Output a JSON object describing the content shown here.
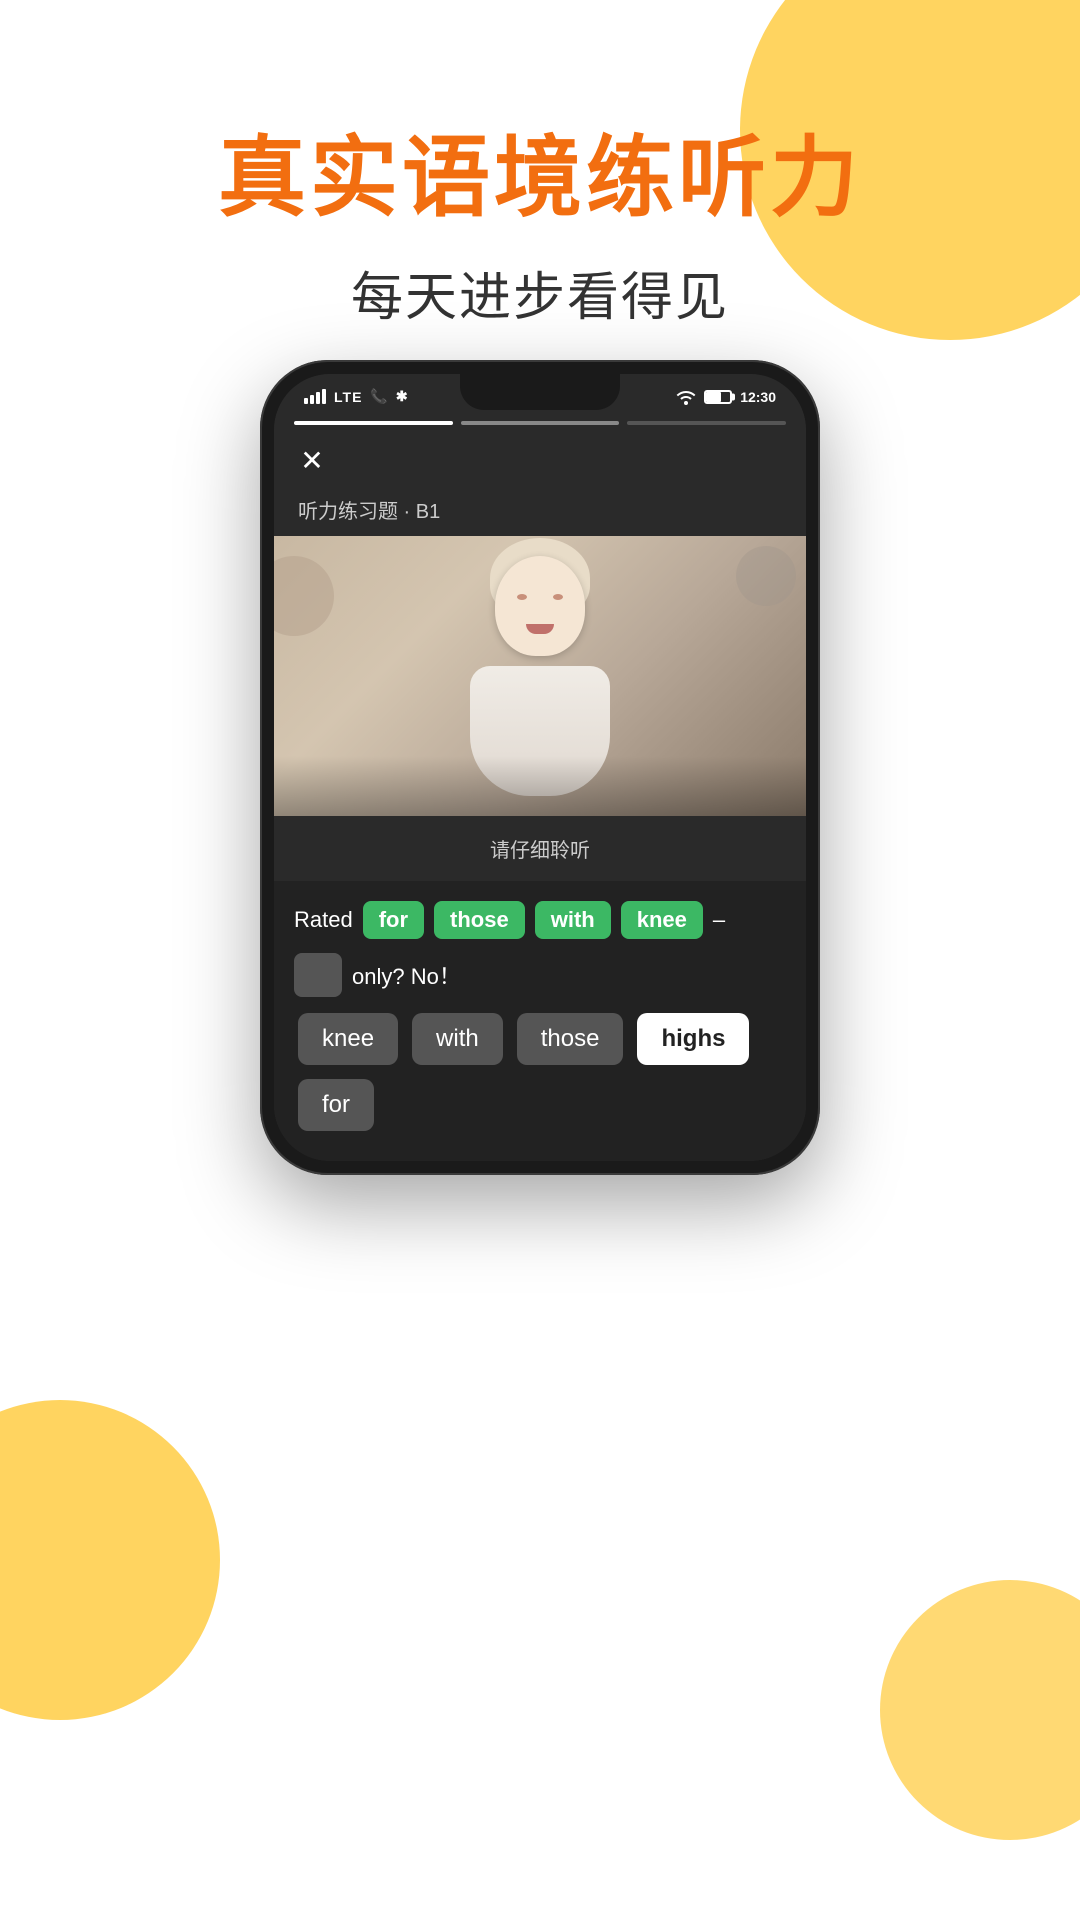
{
  "page": {
    "background_color": "#ffffff"
  },
  "header": {
    "main_title": "真实语境练听力",
    "sub_title": "每天进步看得见",
    "title_color": "#F26E10",
    "sub_color": "#333333"
  },
  "phone": {
    "status_bar": {
      "signal": "LTE",
      "time": "12:30",
      "wifi": true,
      "battery": true
    },
    "progress_segments": [
      "done",
      "active",
      "todo"
    ],
    "exercise_label": "听力练习题 · B1",
    "instruction": "请仔细聆听",
    "sentence_part1": "Rated",
    "sentence_words": [
      "for",
      "those",
      "with",
      "knee"
    ],
    "dash": "–",
    "second_line_extra": "only?  No！",
    "word_choices": [
      {
        "word": "knee",
        "state": "default"
      },
      {
        "word": "with",
        "state": "default"
      },
      {
        "word": "those",
        "state": "default"
      },
      {
        "word": "highs",
        "state": "selected"
      },
      {
        "word": "for",
        "state": "default"
      }
    ]
  },
  "icons": {
    "close": "✕",
    "wifi": "📶",
    "battery": "🔋"
  }
}
